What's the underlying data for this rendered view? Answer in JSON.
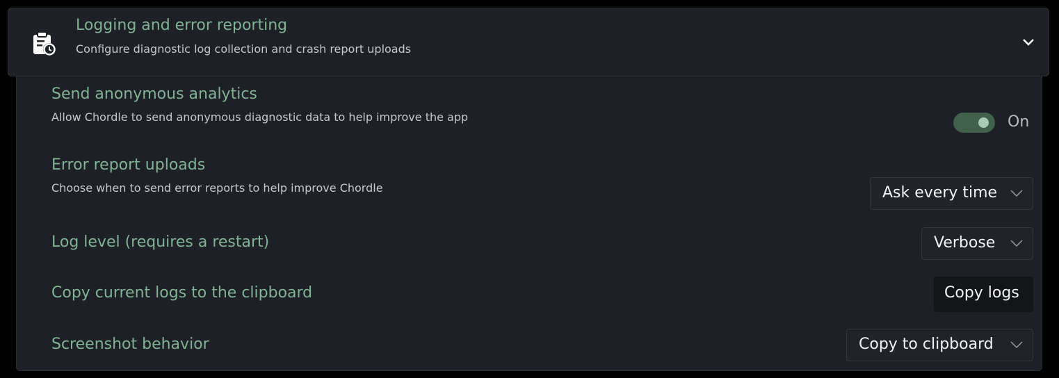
{
  "header": {
    "icon": "clipboard-clock-icon",
    "title": "Logging and error reporting",
    "subtitle": "Configure diagnostic log collection and crash report uploads",
    "expand_icon": "chevron-down-icon"
  },
  "settings": {
    "analytics": {
      "title": "Send anonymous analytics",
      "description": "Allow Chordle to send anonymous diagnostic data to help improve the app",
      "toggle_on": true,
      "state_label": "On"
    },
    "error_reports": {
      "title": "Error report uploads",
      "description": "Choose when to send error reports to help improve Chordle",
      "selected": "Ask every time"
    },
    "log_level": {
      "title": "Log level (requires a restart)",
      "selected": "Verbose"
    },
    "copy_logs": {
      "title": "Copy current logs to the clipboard",
      "button_label": "Copy logs"
    },
    "screenshot": {
      "title": "Screenshot behavior",
      "selected": "Copy to clipboard"
    }
  },
  "colors": {
    "accent": "#7fb393",
    "panel": "#1d2026",
    "toggle_track": "#41614c"
  }
}
